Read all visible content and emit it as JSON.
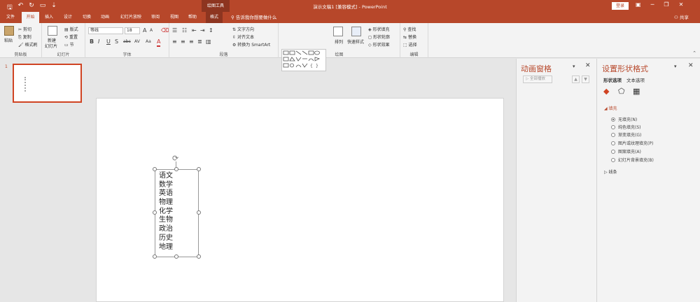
{
  "titlebar": {
    "doc_title": "演示文稿1 [兼容模式] - PowerPoint",
    "context_tool": "绘图工具",
    "login": "登录",
    "min": "─",
    "restore": "❐",
    "close": "✕"
  },
  "tabs": {
    "file": "文件",
    "home": "开始",
    "insert": "插入",
    "design": "设计",
    "transitions": "切换",
    "animations": "动画",
    "slideshow": "幻灯片放映",
    "review": "审阅",
    "view": "视图",
    "help": "帮助",
    "format": "格式",
    "tellme": "告诉我你想要做什么",
    "share": "共享"
  },
  "ribbon": {
    "clipboard": {
      "paste": "粘贴",
      "cut": "剪切",
      "copy": "复制",
      "format_painter": "格式刷",
      "label": "剪贴板"
    },
    "slides": {
      "new_slide": "新建",
      "new_slide2": "幻灯片",
      "layout": "版式",
      "reset": "重置",
      "section": "节",
      "label": "幻灯片"
    },
    "font": {
      "name": "等线",
      "size": "18",
      "label": "字体",
      "grow": "A",
      "shrink": "A",
      "bold": "B",
      "italic": "I",
      "underline": "U",
      "strike": "S",
      "abc": "abc",
      "spacing": "AV",
      "case": "Aa",
      "color": "A"
    },
    "paragraph": {
      "text_direction": "文字方向",
      "align_text": "对齐文本",
      "smartart": "转换为 SmartArt",
      "label": "段落"
    },
    "drawing": {
      "arrange": "排列",
      "quick_styles": "快速样式",
      "fill": "形状填充",
      "outline": "形状轮廓",
      "effects": "形状效果",
      "label": "绘图"
    },
    "editing": {
      "find": "查找",
      "replace": "替换",
      "select": "选择",
      "label": "编辑"
    }
  },
  "thumbs": {
    "slide_number": "1"
  },
  "slide": {
    "lines": [
      "语文",
      "数学",
      "英语",
      "物理",
      "化学",
      "生物",
      "政治",
      "历史",
      "地理"
    ]
  },
  "animation_pane": {
    "title": "动画窗格",
    "play_all": "全部播放",
    "up": "▲",
    "down": "▼"
  },
  "format_pane": {
    "title": "设置形状格式",
    "tab_shape": "形状选项",
    "tab_text": "文本选项",
    "fill_section": "填充",
    "line_section": "线条",
    "options": [
      {
        "label": "无填充(N)",
        "selected": true
      },
      {
        "label": "纯色填充(S)",
        "selected": false
      },
      {
        "label": "渐变填充(G)",
        "selected": false
      },
      {
        "label": "图片或纹理填充(P)",
        "selected": false
      },
      {
        "label": "图案填充(A)",
        "selected": false
      },
      {
        "label": "幻灯片背景填充(B)",
        "selected": false
      }
    ]
  },
  "colors": {
    "brand": "#b7472a",
    "context": "#8d3520"
  }
}
